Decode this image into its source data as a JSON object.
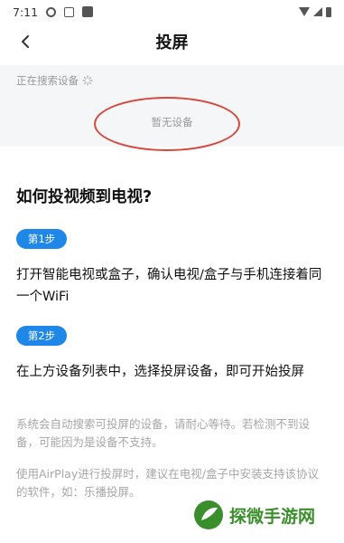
{
  "status_bar": {
    "time": "7:11",
    "icons": [
      "settings-icon",
      "a-notification-icon",
      "app-notification-icon",
      "wifi-icon",
      "signal-icon",
      "battery-icon"
    ]
  },
  "nav": {
    "back_icon": "chevron-left-icon",
    "title": "投屏"
  },
  "search": {
    "status_text": "正在搜索设备",
    "empty_text": "暂无设备",
    "highlight_color": "#d9463a"
  },
  "guide": {
    "title": "如何投视频到电视?",
    "steps": [
      {
        "label": "第1步",
        "text": "打开智能电视或盒子，确认电视/盒子与手机连接着同一个WiFi"
      },
      {
        "label": "第2步",
        "text": "在上方设备列表中，选择投屏设备，即可开始投屏"
      }
    ],
    "notes": [
      "系统会自动搜索可投屏的设备，请耐心等待。若检测不到设备，可能因为是设备不支持。",
      "使用AirPlay进行投屏时，建议在电视/盒子中安装支持该协议的软件，如：乐播投屏。"
    ],
    "accent_color": "#1e87e8"
  },
  "watermark": {
    "text": "探微手游网"
  }
}
